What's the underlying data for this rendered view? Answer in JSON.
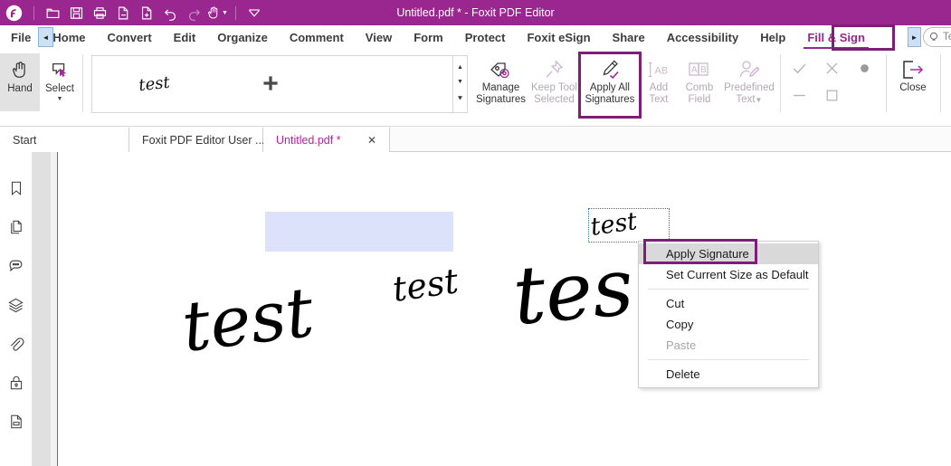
{
  "window": {
    "title": "Untitled.pdf * - Foxit PDF Editor",
    "brand_color": "#99278f",
    "accent_color": "#7d1f78",
    "highlight_color": "#b4249f"
  },
  "quick_access": {
    "logo": "foxit-logo-icon",
    "items": [
      {
        "name": "open-icon",
        "glyph": "open"
      },
      {
        "name": "save-icon",
        "glyph": "save"
      },
      {
        "name": "print-icon",
        "glyph": "print"
      },
      {
        "name": "create-from-file-icon",
        "glyph": "createfile"
      },
      {
        "name": "create-blank-icon",
        "glyph": "createblank"
      },
      {
        "name": "undo-icon",
        "glyph": "undo"
      },
      {
        "name": "redo-icon",
        "glyph": "redo"
      },
      {
        "name": "hand-tool-icon",
        "glyph": "hand"
      },
      {
        "name": "customize-toolbar-icon",
        "glyph": "caret"
      }
    ]
  },
  "menubar": {
    "scroll_left": "◄",
    "scroll_right": "►",
    "items": [
      {
        "label": "File",
        "active": false
      },
      {
        "label": "Home",
        "active": false
      },
      {
        "label": "Convert",
        "active": false
      },
      {
        "label": "Edit",
        "active": false
      },
      {
        "label": "Organize",
        "active": false
      },
      {
        "label": "Comment",
        "active": false
      },
      {
        "label": "View",
        "active": false
      },
      {
        "label": "Form",
        "active": false
      },
      {
        "label": "Protect",
        "active": false
      },
      {
        "label": "Foxit eSign",
        "active": false
      },
      {
        "label": "Share",
        "active": false
      },
      {
        "label": "Accessibility",
        "active": false
      },
      {
        "label": "Help",
        "active": false
      },
      {
        "label": "Fill & Sign",
        "active": true
      }
    ],
    "tell_me_placeholder": "Tell me"
  },
  "ribbon": {
    "hand_label": "Hand",
    "select_label": "Select",
    "gallery": {
      "signature_preview": "test",
      "add_label": "+",
      "scroll_up": "▲",
      "scroll_down": "▼",
      "scroll_more": "☰"
    },
    "manage_signatures": "Manage\nSignatures",
    "manage_signatures_l1": "Manage",
    "manage_signatures_l2": "Signatures",
    "keep_tool_l1": "Keep Tool",
    "keep_tool_l2": "Selected",
    "apply_all_l1": "Apply All",
    "apply_all_l2": "Signatures",
    "add_text_l1": "Add",
    "add_text_l2": "Text",
    "comb_field_l1": "Comb",
    "comb_field_l2": "Field",
    "predefined_l1": "Predefined",
    "predefined_l2": "Text",
    "close_label": "Close"
  },
  "tabs": [
    {
      "label": "Start",
      "active": false,
      "closeable": false
    },
    {
      "label": "Foxit PDF Editor User ...",
      "active": false,
      "closeable": false
    },
    {
      "label": "Untitled.pdf *",
      "active": true,
      "closeable": true,
      "close_glyph": "✕"
    }
  ],
  "sidebar": {
    "items": [
      {
        "name": "bookmarks-icon"
      },
      {
        "name": "pages-icon"
      },
      {
        "name": "comments-icon"
      },
      {
        "name": "layers-icon"
      },
      {
        "name": "attachments-icon"
      },
      {
        "name": "security-icon"
      },
      {
        "name": "form-fields-icon"
      }
    ]
  },
  "canvas": {
    "signatures": [
      {
        "name": "signature-large",
        "text": "test"
      },
      {
        "name": "signature-medium",
        "text": "test"
      },
      {
        "name": "signature-large-2",
        "text": "tes"
      },
      {
        "name": "signature-selected",
        "text": "test"
      }
    ],
    "form_field": "",
    "selection_border_color": "#2f6fd0"
  },
  "context_menu": {
    "items": [
      {
        "label": "Apply Signature",
        "highlighted": true,
        "disabled": false
      },
      {
        "label": "Set Current Size as Default",
        "highlighted": false,
        "disabled": false
      },
      {
        "separator_after": true
      },
      {
        "label": "Cut",
        "highlighted": false,
        "disabled": false
      },
      {
        "label": "Copy",
        "highlighted": false,
        "disabled": false
      },
      {
        "label": "Paste",
        "highlighted": false,
        "disabled": true
      },
      {
        "separator_after": true
      },
      {
        "label": "Delete",
        "highlighted": false,
        "disabled": false
      }
    ]
  }
}
